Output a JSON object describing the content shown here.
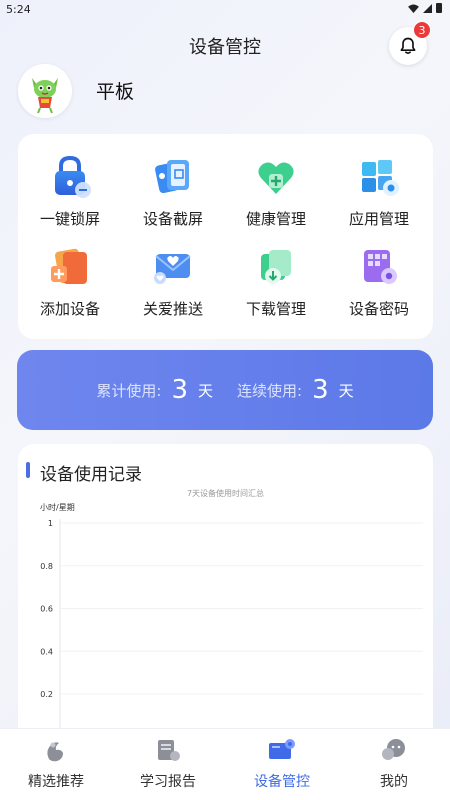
{
  "status_bar": {
    "time": "5:24"
  },
  "header": {
    "title": "设备管控",
    "notification_count": "3"
  },
  "profile": {
    "device_name": "平板"
  },
  "grid": {
    "items": [
      {
        "label": "一键锁屏",
        "icon": "lock-icon"
      },
      {
        "label": "设备截屏",
        "icon": "screenshot-icon"
      },
      {
        "label": "健康管理",
        "icon": "health-icon"
      },
      {
        "label": "应用管理",
        "icon": "apps-icon"
      },
      {
        "label": "添加设备",
        "icon": "add-device-icon"
      },
      {
        "label": "关爱推送",
        "icon": "envelope-heart-icon"
      },
      {
        "label": "下载管理",
        "icon": "download-icon"
      },
      {
        "label": "设备密码",
        "icon": "password-icon"
      }
    ]
  },
  "usage": {
    "total_label": "累计使用:",
    "total_days": "3",
    "consecutive_label": "连续使用:",
    "consecutive_days": "3",
    "unit": "天"
  },
  "record": {
    "title": "设备使用记录",
    "chart_data": {
      "type": "line",
      "title": "7天设备使用时间汇总",
      "ylabel": "小时/星期",
      "xlabel": "",
      "ylim": [
        0,
        1
      ],
      "yticks": [
        "1",
        "0.8",
        "0.6",
        "0.4",
        "0.2"
      ],
      "grid": true
    }
  },
  "bottom_nav": {
    "items": [
      {
        "label": "精选推荐",
        "icon": "featured-icon",
        "active": false
      },
      {
        "label": "学习报告",
        "icon": "report-icon",
        "active": false
      },
      {
        "label": "设备管控",
        "icon": "device-control-icon",
        "active": true
      },
      {
        "label": "我的",
        "icon": "profile-icon",
        "active": false
      }
    ]
  },
  "colors": {
    "accent": "#3f6be8",
    "banner": "#6a82ec",
    "badge": "#ea3a3a"
  }
}
